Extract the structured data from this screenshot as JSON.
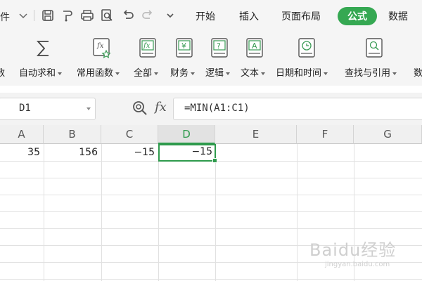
{
  "menu": {
    "file_partial": "件",
    "tabs": [
      "开始",
      "插入",
      "页面布局",
      "公式",
      "数据"
    ],
    "active_tab": "公式"
  },
  "quick_access_icons": [
    "save-icon",
    "format-painter-icon",
    "print-icon",
    "print-preview-icon",
    "undo-icon",
    "redo-icon",
    "customize-icon"
  ],
  "ribbon": {
    "items": [
      {
        "label": "数",
        "icon": "partial-function-icon"
      },
      {
        "label": "自动求和",
        "icon": "sigma-icon"
      },
      {
        "label": "常用函数",
        "icon": "fx-star-icon"
      },
      {
        "label": "全部",
        "icon": "fx-book-icon"
      },
      {
        "label": "财务",
        "icon": "yen-book-icon"
      },
      {
        "label": "逻辑",
        "icon": "question-book-icon"
      },
      {
        "label": "文本",
        "icon": "text-book-icon"
      },
      {
        "label": "日期和时间",
        "icon": "clock-book-icon"
      },
      {
        "label": "查找与引用",
        "icon": "search-book-icon"
      },
      {
        "label": "数",
        "icon": "partial-math-icon"
      }
    ]
  },
  "formula_bar": {
    "name_box": "D1",
    "fx_label": "fx",
    "formula": "=MIN(A1:C1)"
  },
  "sheet": {
    "columns": [
      "A",
      "B",
      "C",
      "D",
      "E",
      "F",
      "G"
    ],
    "selected_column": "D",
    "row1": [
      "35",
      "156",
      "−15",
      "−15",
      "",
      "",
      ""
    ],
    "active_cell": "D1"
  },
  "watermark": {
    "brand": "Baidu经验",
    "url": "jingyan.baidu.com"
  },
  "colors": {
    "accent_green": "#35a852",
    "selection_green": "#2e9a4c"
  }
}
